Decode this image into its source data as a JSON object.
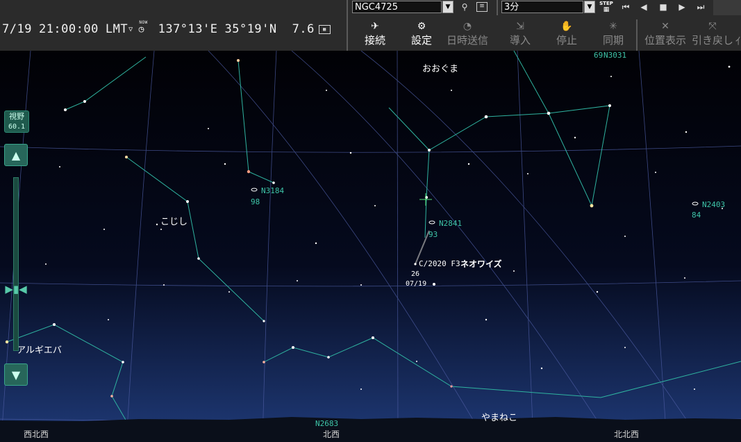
{
  "toolbar": {
    "object_name": "NGC4725",
    "step_value": "3分",
    "step_badge": "STEP",
    "status": {
      "date": "7/19",
      "time": "21:00:00",
      "zone": "LMT",
      "now_badge": "NOW",
      "longitude": "137°13'E",
      "latitude": "35°19'N",
      "zoom": "7.6"
    },
    "buttons": [
      {
        "label": "接続",
        "icon": "satellite-icon",
        "enabled": true
      },
      {
        "label": "設定",
        "icon": "gear-icon",
        "enabled": true
      },
      {
        "label": "日時送信",
        "icon": "clock-send-icon",
        "enabled": false
      },
      {
        "label": "導入",
        "icon": "telescope-goto-icon",
        "enabled": false
      },
      {
        "label": "停止",
        "icon": "stop-hand-icon",
        "enabled": false
      },
      {
        "label": "同期",
        "icon": "sync-icon",
        "enabled": false
      },
      {
        "label": "位置表示",
        "icon": "position-icon",
        "enabled": false
      },
      {
        "label": "引き戻し",
        "icon": "pullback-icon",
        "enabled": false
      }
    ]
  },
  "fov": {
    "label": "視野",
    "value": "60.1"
  },
  "sky": {
    "constellations": [
      {
        "name": "おおぐま"
      },
      {
        "name": "こじし"
      },
      {
        "name": "やまねこ"
      }
    ],
    "star_labels": [
      {
        "name": "アルギエバ"
      }
    ],
    "comet": {
      "designation": "C/2020 F3",
      "name": "ネオワイズ",
      "day": "26",
      "date": "07/19"
    },
    "galaxies": [
      {
        "id": "N3184",
        "mag": "98"
      },
      {
        "id": "N2841",
        "mag": "93"
      },
      {
        "id": "N2403",
        "mag": "84"
      },
      {
        "id": "N2683",
        "mag": ""
      },
      {
        "id": "N3031",
        "mag": "69"
      }
    ],
    "directions": [
      "西北西",
      "北西",
      "北北西"
    ]
  },
  "colors": {
    "constellation_line": "#2fb3a0",
    "grid_line": "#5060a8",
    "galaxy_label": "#3ec4a8",
    "toolbar_bg": "#2b2b2b"
  }
}
